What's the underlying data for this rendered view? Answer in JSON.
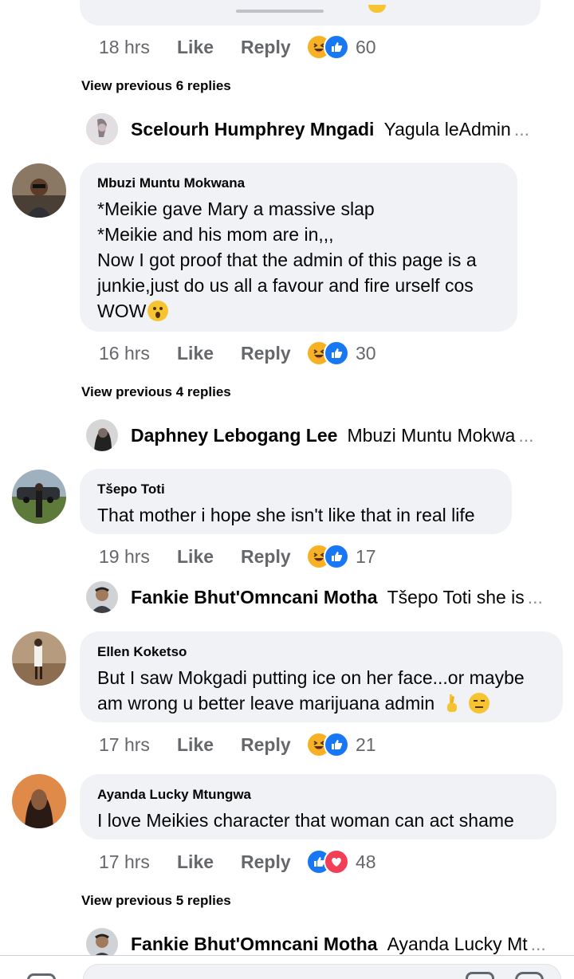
{
  "comments": [
    {
      "time": "18 hrs",
      "like": "Like",
      "reply": "Reply",
      "count": "60"
    },
    {
      "author": "Mbuzi Muntu Mokwana",
      "lines": [
        "*Meikie gave Mary a massive slap",
        "*Meikie and his mom are in,,,",
        "Now I got proof that the admin of this page is a",
        "junkie,just do us all a favour and fire urself cos",
        "WOW"
      ],
      "time": "16 hrs",
      "like": "Like",
      "reply": "Reply",
      "count": "30"
    },
    {
      "author": "Tšepo Toti",
      "text": "That mother i hope she isn't like that in real life",
      "time": "19 hrs",
      "like": "Like",
      "reply": "Reply",
      "count": "17"
    },
    {
      "author": "Ellen Koketso",
      "lines": [
        "But I saw Mokgadi putting ice on her face...or maybe",
        "am wrong u better leave marijuana admin"
      ],
      "time": "17 hrs",
      "like": "Like",
      "reply": "Reply",
      "count": "21"
    },
    {
      "author": "Ayanda Lucky Mtungwa",
      "text": "I love Meikies character that woman can act shame",
      "time": "17 hrs",
      "like": "Like",
      "reply": "Reply",
      "count": "48"
    }
  ],
  "view_previous": [
    "View previous 6 replies",
    "View previous 4 replies",
    "View previous 5 replies"
  ],
  "reply_previews": [
    {
      "name": "Scelourh Humphrey Mngadi",
      "text": "Yagula leAdmin",
      "ellipsis": "..."
    },
    {
      "name": "Daphney Lebogang Lee",
      "text": "Mbuzi Muntu Mokwa",
      "ellipsis": "..."
    },
    {
      "name": "Fankie Bhut'Omncani Motha",
      "text": "Tšepo Toti she is",
      "ellipsis": "..."
    },
    {
      "name": "Fankie Bhut'Omncani Motha",
      "text": "Ayanda Lucky Mt",
      "ellipsis": "..."
    }
  ],
  "icons": {
    "haha": "haha-reaction-icon",
    "like": "like-reaction-icon",
    "love": "love-reaction-icon"
  }
}
